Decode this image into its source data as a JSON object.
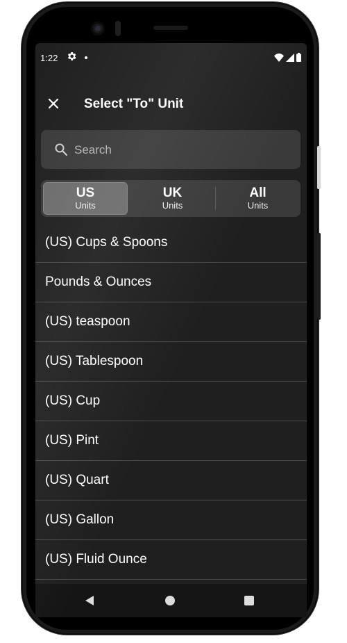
{
  "status_bar": {
    "time": "1:22",
    "icons": [
      "gear-icon",
      "notification-dot",
      "wifi-icon",
      "signal-icon",
      "battery-icon"
    ]
  },
  "app_bar": {
    "close_icon": "close-icon",
    "title": "Select \"To\" Unit"
  },
  "search": {
    "icon": "search-icon",
    "placeholder": "Search",
    "value": ""
  },
  "unit_systems": [
    {
      "label": "US",
      "sublabel": "Units",
      "selected": true
    },
    {
      "label": "UK",
      "sublabel": "Units",
      "selected": false
    },
    {
      "label": "All",
      "sublabel": "Units",
      "selected": false
    }
  ],
  "units": [
    "(US) Cups & Spoons",
    "Pounds & Ounces",
    "(US) teaspoon",
    "(US) Tablespoon",
    "(US) Cup",
    "(US) Pint",
    "(US) Quart",
    "(US) Gallon",
    "(US) Fluid Ounce"
  ],
  "nav_bar": {
    "icons": [
      "back-icon",
      "home-icon",
      "recents-icon"
    ]
  },
  "colors": {
    "screen_bg": "#1f1f1f",
    "control_bg": "#3a3a3a",
    "selected_segment": "#6c6c6c",
    "divider": "#4a4a4a",
    "text": "#ffffff"
  }
}
